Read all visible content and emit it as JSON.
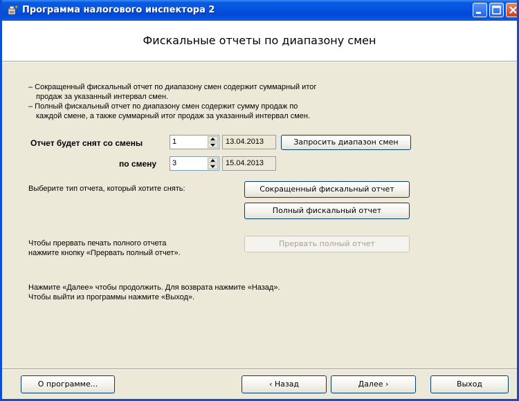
{
  "window": {
    "title": "Программа налогового инспектора 2"
  },
  "header": {
    "title": "Фискальные отчеты по диапазону смен"
  },
  "description": {
    "line1": "– Сокращенный фискальный отчет по диапазону смен содержит суммарный итог",
    "line2": "продаж за указанный интервал смен.",
    "line3": "– Полный фискальный отчет по диапазону смен содержит сумму продаж по",
    "line4": "каждой смене, а также суммарный итог продаж за указанный интервал смен."
  },
  "range": {
    "from_label": "Отчет будет снят со смены",
    "from_value": "1",
    "from_date": "13.04.2013",
    "to_label": "по смену",
    "to_value": "3",
    "to_date": "15.04.2013",
    "request_button": "Запросить диапазон смен"
  },
  "report_type": {
    "prompt": "Выберите тип отчета, который хотите снять:",
    "short_button": "Сокращенный фискальный отчет",
    "full_button": "Полный фискальный отчет"
  },
  "interrupt": {
    "line1": "Чтобы прервать печать полного отчета",
    "line2": "нажмите кнопку «Прервать полный отчет».",
    "button": "Прервать полный отчет"
  },
  "hint": {
    "line1": "Нажмите «Далее» чтобы продолжить. Для возврата нажмите «Назад».",
    "line2": "Чтобы выйти из программы нажмите «Выход»."
  },
  "footer": {
    "about_button": "О программе...",
    "back_button": "‹ Назад",
    "next_button": "Далее ›",
    "exit_button": "Выход"
  },
  "colors": {
    "titlebar": "#0a5be3",
    "window_bg": "#ece9d8",
    "button_border": "#003c74"
  }
}
